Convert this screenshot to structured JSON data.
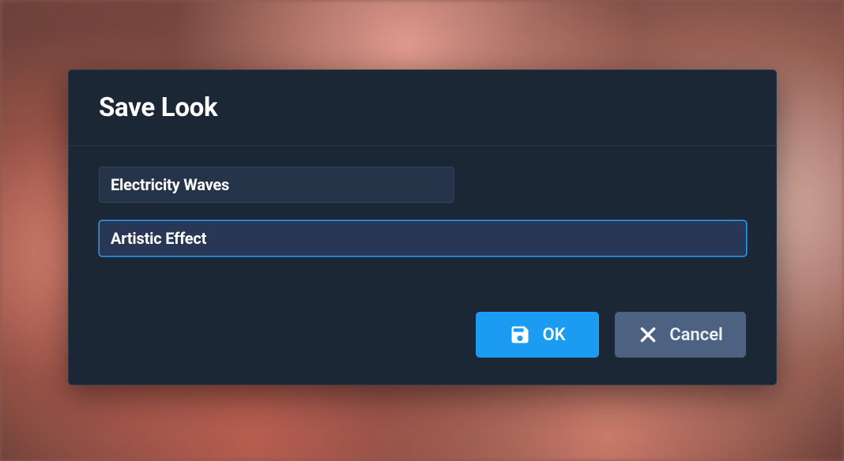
{
  "dialog": {
    "title": "Save Look",
    "fields": {
      "name": {
        "value": "Electricity Waves"
      },
      "category": {
        "value": "Artistic Effect"
      }
    },
    "actions": {
      "ok": {
        "label": "OK"
      },
      "cancel": {
        "label": "Cancel"
      }
    }
  }
}
